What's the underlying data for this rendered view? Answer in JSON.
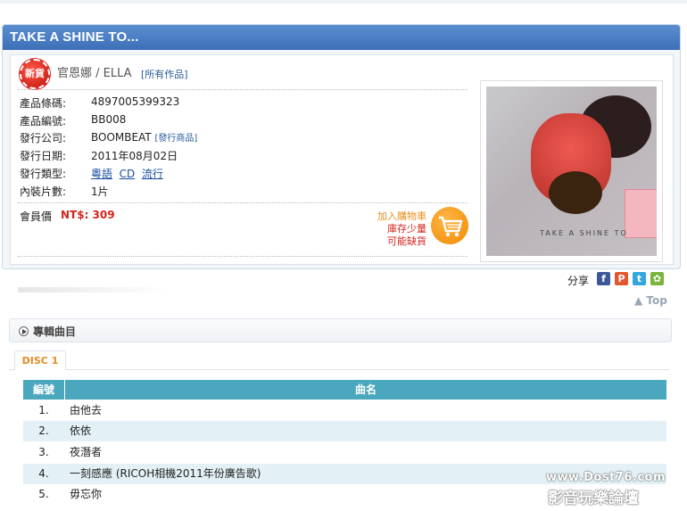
{
  "product": {
    "title": "TAKE A SHINE TO...",
    "badge": "新貨",
    "artist": "官恩娜 / ELLA",
    "all_works_link": "[所有作品]",
    "fields": {
      "barcode_label": "產品條碼:",
      "barcode": "4897005399323",
      "code_label": "產品編號:",
      "code": "BB008",
      "publisher_label": "發行公司:",
      "publisher": "BOOMBEAT",
      "publisher_link": "[發行商品]",
      "date_label": "發行日期:",
      "date": "2011年08月02日",
      "type_label": "發行類型:",
      "type_tags": [
        "粵語",
        "CD",
        "流行"
      ],
      "discs_label": "內裝片數:",
      "discs": "1片"
    },
    "member_price_label": "會員價",
    "member_price": "NT$: 309",
    "cart": {
      "add_label": "加入購物車",
      "stock_line1": "庫存少量",
      "stock_line2": "可能缺貨"
    },
    "cover_text": "TAKE A SHINE TO"
  },
  "share": {
    "label": "分享",
    "icons": [
      "facebook-icon",
      "plurk-icon",
      "twitter-icon",
      "msn-icon"
    ],
    "top_link": "Top"
  },
  "tracklist": {
    "section_title": "專輯曲目",
    "tab": "DISC 1",
    "headers": [
      "編號",
      "曲名"
    ],
    "rows": [
      {
        "no": "1.",
        "name": "由他去"
      },
      {
        "no": "2.",
        "name": "依依"
      },
      {
        "no": "3.",
        "name": "夜潛者"
      },
      {
        "no": "4.",
        "name": "一刻感應 (RICOH相機2011年份廣告歌)"
      },
      {
        "no": "5.",
        "name": "毋忘你"
      }
    ]
  },
  "watermark": {
    "line1": "www.Dost76.com",
    "line2": "影音玩樂論壇"
  },
  "colors": {
    "header_blue": "#4a7fc6",
    "table_header": "#4aa7bd",
    "row_alt": "#e3f1f6",
    "price_red": "#d2261d",
    "tab_orange": "#e88a1e"
  }
}
